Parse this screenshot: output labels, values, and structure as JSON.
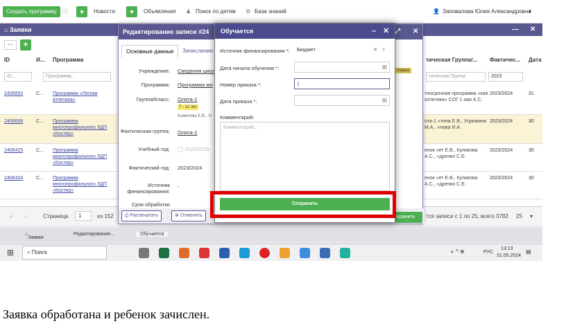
{
  "topbar": {
    "create_program": "Создать программу",
    "news": "Новости",
    "ads": "Объявления",
    "search_children": "Поиск по детям",
    "knowledge_base": "База знаний",
    "user": "Заповалова Юлия Александровна"
  },
  "zayavki": {
    "title": "Заявки",
    "columns": [
      "ID",
      "И...",
      "Программа",
      "тическая Группа/...",
      "Фактичес...",
      "Дата"
    ],
    "filters": {
      "id": "ID...",
      "program": "Программа...",
      "group": "тическая Группа",
      "year": "2023"
    },
    "rows": [
      {
        "id": "2406853",
        "c": "С...",
        "program": "Программа «Легкая атлетика»",
        "group": "тносрочная программа «кая атлетика» СОГ 1 ова А.С.",
        "year": "2023/2024",
        "n": "31"
      },
      {
        "id": "2406666",
        "c": "С...",
        "program": "Программа многопрофильного ЛДП «Костер»",
        "group": "ота-1 «тина Е.В., Угрюмина М.А., «нова И.А.",
        "year": "2023/2024",
        "n": "30"
      },
      {
        "id": "2406425",
        "c": "С...",
        "program": "Программа многопрофильного ЛДП «Костер»",
        "group": "енок «ет Е.В., Куликова А.С., «дренко С.Е.",
        "year": "2023/2024",
        "n": "30"
      },
      {
        "id": "2406424",
        "c": "С...",
        "program": "Программа многопрофильного ЛДП «Костер»",
        "group": "енок «ет Е.В., Куликова А.С., «дренко С.Е.",
        "year": "2023/2024",
        "n": "30"
      }
    ],
    "pager": {
      "page_label": "Страница",
      "page": "1",
      "of": "из 152",
      "records": "тся записи с 1 по 25, всего 3782",
      "per_page": "25"
    }
  },
  "edit": {
    "title": "Редактирование записи #24",
    "tab_main": "Основные данные",
    "tab_enrolled": "Зачисление",
    "fields": [
      {
        "label": "Учреждение:",
        "value": "Сведения школ"
      },
      {
        "label": "Программа:",
        "value": "Программа мн"
      },
      {
        "label": "Группа/Класс:",
        "value": "Олята-1"
      },
      {
        "label": "Фактическая группа:",
        "value": "Олята-1"
      },
      {
        "label": "Учебный год:",
        "value": "2024/2025"
      },
      {
        "label": "Фактический год:",
        "value": "2023/2024"
      },
      {
        "label": "Источник финансирования:",
        "value": "-"
      },
      {
        "label": "Срок обработки",
        "value": ""
      }
    ],
    "group_badge": "7 - 11 лет",
    "group_teacher": "Комилова Е.В., Уг",
    "print_button": "Распечатать",
    "cancel_button": "Отменить",
    "save_right": "Сохранить",
    "badge_right": "ладна"
  },
  "dialog": {
    "title": "Обучается",
    "finance_label": "Источник финансирования *:",
    "finance_value": "Бюджет",
    "start_label": "Дата начала обучения *:",
    "order_no_label": "Номер приказа *:",
    "order_date_label": "Дата приказа *:",
    "comment_label": "Комментарий:",
    "comment_placeholder": "Комментарий...",
    "save_button": "Сохранить"
  },
  "tabs": [
    "Заявки",
    "Редактирование...",
    "Обучается"
  ],
  "taskbar": {
    "search": "Поиск",
    "lang": "РУС",
    "time": "13:13",
    "date": "31.05.2024"
  },
  "caption": "Заявка обработана и ребенок зачислен."
}
